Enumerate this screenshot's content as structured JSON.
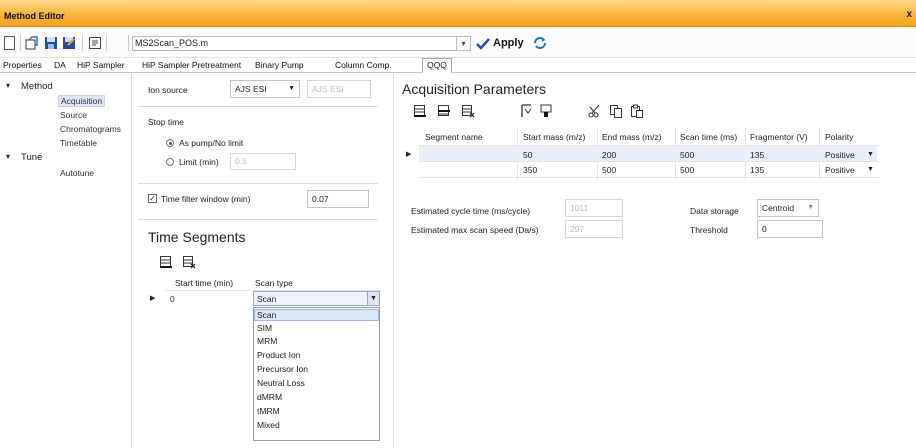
{
  "window": {
    "title": "Method Editor",
    "close": "x"
  },
  "toolbar": {
    "method_file": "MS2Scan_POS.m",
    "apply_label": "Apply",
    "icons": [
      "new-file-icon",
      "open-icon",
      "save-icon",
      "save-as-icon",
      "print-icon",
      "refresh-icon"
    ]
  },
  "tabs": [
    "Properties",
    "DA",
    "HiP Sampler",
    "HiP Sampler Pretreatment",
    "Binary Pump",
    "Column Comp.",
    "QQQ"
  ],
  "tree": {
    "method": "Method",
    "method_children": [
      "Acquisition",
      "Source",
      "Chromatograms",
      "Timetable"
    ],
    "tune": "Tune",
    "tune_children": [
      "Autotune"
    ],
    "expander": "▾"
  },
  "settings": {
    "ion_source_label": "Ion source",
    "ion_source_value": "AJS ESI",
    "ion_source_display": "AJS ESI",
    "stop_time_label": "Stop time",
    "stop_as_pump": "As pump/No limit",
    "stop_limit": "Limit (min)",
    "stop_limit_value": "0.5",
    "time_filter_label": "Time filter window (min)",
    "time_filter_checked": "✓",
    "time_filter_value": "0.07"
  },
  "time_segments": {
    "title": "Time Segments",
    "columns": [
      "Start time (min)",
      "Scan type"
    ],
    "rows": [
      {
        "start": "0",
        "scan_type": "Scan"
      }
    ],
    "row_marker": "▶",
    "dropdown_options": [
      "Scan",
      "SIM",
      "MRM",
      "Product Ion",
      "Precursor Ion",
      "Neutral Loss",
      "dMRM",
      "tMRM",
      "Mixed"
    ],
    "selected": "Scan"
  },
  "acquisition": {
    "title": "Acquisition Parameters",
    "columns": [
      "Segment name",
      "Start mass (m/z)",
      "End mass (m/z)",
      "Scan time (ms)",
      "Fragmentor (V)",
      "Polarity"
    ],
    "rows": [
      {
        "segment_name": "",
        "start_mass": "50",
        "end_mass": "200",
        "scan_time": "500",
        "fragmentor": "135",
        "polarity": "Positive"
      },
      {
        "segment_name": "",
        "start_mass": "350",
        "end_mass": "500",
        "scan_time": "500",
        "fragmentor": "135",
        "polarity": "Positive"
      }
    ],
    "row_marker": "▶",
    "dropdown_arrow": "▼",
    "est_cycle_label": "Estimated cycle time (ms/cycle)",
    "est_cycle_value": "1011",
    "est_speed_label": "Estimated max scan speed (Da/s)",
    "est_speed_value": "297",
    "data_storage_label": "Data storage",
    "data_storage_value": "Centroid",
    "threshold_label": "Threshold",
    "threshold_value": "0"
  }
}
